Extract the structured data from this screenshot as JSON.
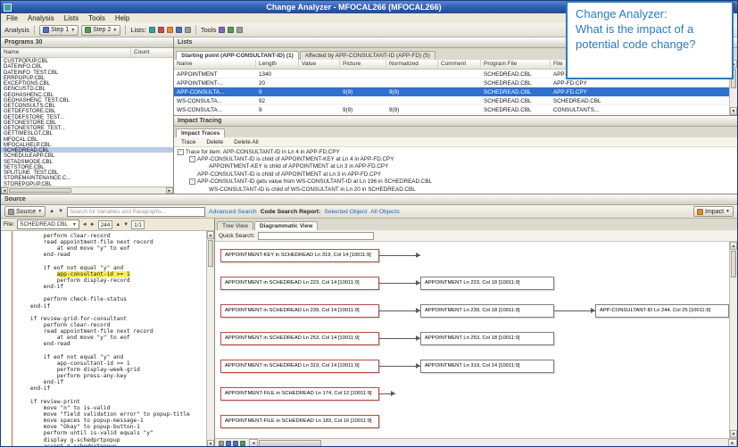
{
  "window": {
    "title": "Change Analyzer - MFOCAL266 (MFOCAL266)"
  },
  "menu": {
    "items": [
      "File",
      "Analysis",
      "Lists",
      "Tools",
      "Help"
    ]
  },
  "toolbar": {
    "analysis": "Analysis",
    "step1": "Step 1",
    "step2": "Step 2",
    "lists": "Lists:",
    "tools": "Tools"
  },
  "programs": {
    "title": "Programs 30",
    "columns": [
      "Name",
      "Count"
    ],
    "selected": "SCHEDREAD.CBL",
    "items": [
      "CUSTPOPUP.CBL",
      "DATEINFO.CBL",
      "DATEINFO_TEST.CBL",
      "ERRPOPUP.CBL",
      "EXCEPTIONS.CBL",
      "GENCUSTD.CBL",
      "GEOHASHENC.CBL",
      "GEOHASHENC_TEST.CBL",
      "GETCONSULTS.CBL",
      "GETDEFSTORE.CBL",
      "GETDEFSTORE_TEST...",
      "GETONESTORE.CBL",
      "GETONESTORE_TEST...",
      "GETTIMESLOT.CBL",
      "MFOCAL.CBL",
      "MFOCALHELP.CBL",
      "SCHEDREAD.CBL",
      "SCHEDULEAPP.CBL",
      "SETADSMODE.CBL",
      "SETSTORE.CBL",
      "SPLITLINE_TEST.CBL",
      "STOREMAINTENANCE.C...",
      "STOREPOPUP.CBL"
    ]
  },
  "lists": {
    "title": "Lists",
    "tabs": [
      "Starting point (APP-CONSULTANT-ID) (1)",
      "Affected by APP-CONSULTANT-ID (APP-FD) (5)"
    ],
    "columns": [
      "Name",
      "Length",
      "Value",
      "Picture",
      "Normalized",
      "Comment",
      "Program File",
      "File"
    ],
    "selected_row": 2,
    "rows": [
      [
        "APPOINTMENT",
        "1340",
        "",
        "",
        "",
        "",
        "SCHEDREAD.CBL",
        "APP-FD.CPY"
      ],
      [
        "APPOINTMENT-...",
        "20",
        "",
        "",
        "",
        "",
        "SCHEDREAD.CBL",
        "APP-FD.CPY"
      ],
      [
        "APP-CONSULTA...",
        "9",
        "",
        "9(9)",
        "9(9)",
        "",
        "SCHEDREAD.CBL",
        "APP-FD.CPY"
      ],
      [
        "WS-CONSULTA...",
        "92",
        "",
        "",
        "",
        "",
        "SCHEDREAD.CBL",
        "SCHEDREAD.CBL"
      ],
      [
        "WS-CONSULTA...",
        "9",
        "",
        "9(9)",
        "9(9)",
        "",
        "SCHEDREAD.CBL",
        "CONSULTANTS..."
      ]
    ]
  },
  "impact_tracing": {
    "title": "Impact Tracing",
    "tab": "Impact Traces",
    "buttons": [
      "Trace",
      "Delete",
      "Delete All"
    ],
    "tree": [
      {
        "level": 0,
        "expander": true,
        "text": "Trace for item: APP-CONSULTANT-ID in Ln 4 in APP-FD.CPY"
      },
      {
        "level": 1,
        "expander": true,
        "text": "APP-CONSULTANT-ID is child of APPOINTMENT-KEY at Ln 4 in APP-FD.CPY"
      },
      {
        "level": 2,
        "expander": false,
        "text": "APPOINTMENT-KEY is child of APPOINTMENT at Ln 3 in APP-FD.CPY"
      },
      {
        "level": 1,
        "expander": false,
        "text": "APP-CONSULTANT-ID is child of APPOINTMENT at Ln 3 in APP-FD.CPY"
      },
      {
        "level": 1,
        "expander": true,
        "text": "APP-CONSULTANT-ID gets value from WS-CONSULTANT-ID at Ln 196 in SCHEDREAD.CBL"
      },
      {
        "level": 2,
        "expander": false,
        "text": "WS-CONSULTANT-ID is child of WS-CONSULTANT in Ln 20 in SCHEDREAD.CBL"
      }
    ]
  },
  "source": {
    "title": "Source",
    "dropdown_label": "Source",
    "search_placeholder": "Search for Variables and Paragraphs...",
    "file_label": "File:",
    "file_value": "SCHEDREAD.CBL",
    "line_indicator": "244",
    "page_indicator": "1/1",
    "code_lines": [
      {
        "t": "        perform clear-record"
      },
      {
        "t": "        read appointment-file next record"
      },
      {
        "t": "            at end move \"y\" to eof"
      },
      {
        "t": "        end-read"
      },
      {
        "t": ""
      },
      {
        "t": "        if eof not equal \"y\" and"
      },
      {
        "t": "            app-consultant-id >= 1",
        "hl": true
      },
      {
        "t": "            perform display-record"
      },
      {
        "t": "        end-if"
      },
      {
        "t": ""
      },
      {
        "t": "        perform check-file-status"
      },
      {
        "t": "    end-if"
      },
      {
        "t": ""
      },
      {
        "t": "    if review-grid-for-consultant"
      },
      {
        "t": "        perform clear-record"
      },
      {
        "t": "        read appointment-file next record"
      },
      {
        "t": "            at end move \"y\" to eof"
      },
      {
        "t": "        end-read"
      },
      {
        "t": ""
      },
      {
        "t": "        if eof not equal \"y\" and"
      },
      {
        "t": "            app-consultant-id >= 1"
      },
      {
        "t": "            perform display-week-grid"
      },
      {
        "t": "            perform press-any-key"
      },
      {
        "t": "        end-if"
      },
      {
        "t": "    end-if"
      },
      {
        "t": ""
      },
      {
        "t": "    if review-print"
      },
      {
        "t": "        move \"n\" to is-valid"
      },
      {
        "t": "        move \"field validation error\" to popup-title"
      },
      {
        "t": "        move spaces to popup-message-1"
      },
      {
        "t": "        move \"Okay\" to popup-button-1"
      },
      {
        "t": "        perform until is-valid equals \"y\""
      },
      {
        "t": "        display g-schedprtpopup"
      },
      {
        "t": "        accept g-schedprtpopup"
      }
    ]
  },
  "code_search": {
    "advanced_search": "Advanced Search",
    "report_label": "Code Search Report:",
    "selected_object": "Selected Object",
    "all_objects": "All Objects",
    "impact_button": "Impact",
    "tabs": [
      "Tree View",
      "Diagrammatic View"
    ],
    "quick_search_label": "Quick Search:",
    "diagram_rows": [
      {
        "source": "APPOINTMENT-KEY in SCHEDREAD Ln 319, Col 14 [10011:9]",
        "targets": [],
        "stub": "long"
      },
      {
        "source": "APPOINTMENT in SCHEDREAD Ln 223, Col 14 [10011:9]",
        "targets": [
          "APPOINTMENT Ln 223, Col 18 [10011:9]"
        ]
      },
      {
        "source": "APPOINTMENT in SCHEDREAD Ln 239, Col 14 [10011:9]",
        "targets": [
          "APPOINTMENT Ln 239, Col 18 [10011:9]",
          "APP-CONSULTANT-ID Ln 244, Col 25 [10011:9]"
        ]
      },
      {
        "source": "APPOINTMENT in SCHEDREAD Ln 253, Col 14 [10011:9]",
        "targets": [
          "APPOINTMENT Ln 253, Col 18 [10011:9]"
        ]
      },
      {
        "source": "APPOINTMENT in SCHEDREAD Ln 319, Col 14 [10011:9]",
        "targets": [
          "APPOINTMENT Ln 319, Col 14 [10011:9]"
        ]
      },
      {
        "source": "APPOINTMENT-FILE in SCHEDREAD Ln 174, Col 12 [10011:9]",
        "targets": [],
        "stub": "short"
      },
      {
        "source": "APPOINTMENT-FILE in SCHEDREAD Ln 183, Col 16 [10011:9]",
        "targets": []
      }
    ]
  },
  "callout": {
    "line1": "Change Analyzer:",
    "line2": "What is the impact of a",
    "line3": "potential code change?"
  }
}
